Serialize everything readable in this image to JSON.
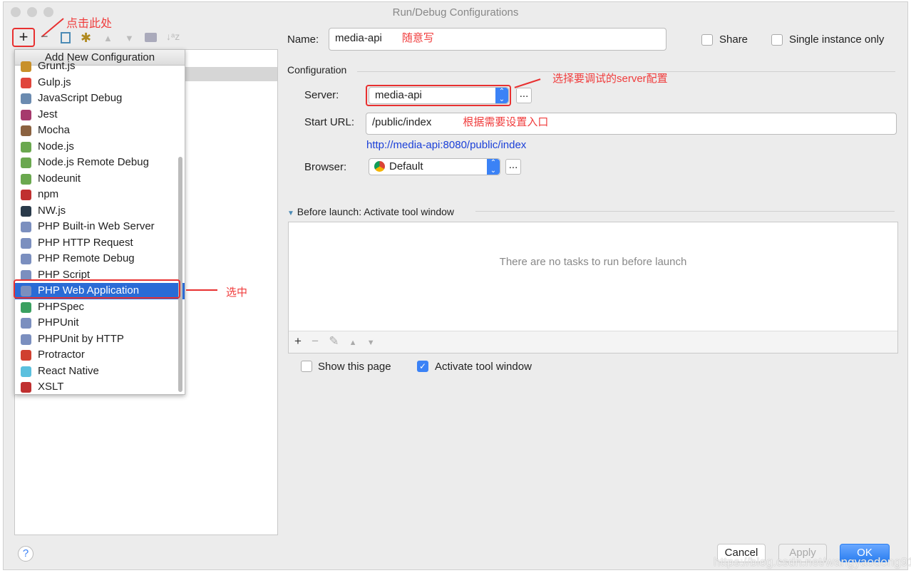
{
  "window": {
    "title": "Run/Debug Configurations"
  },
  "annotations": {
    "click_here": "点击此处",
    "name_hint": "随意写",
    "server_hint": "选择要调试的server配置",
    "url_hint": "根据需要设置入口",
    "selected_hint": "选中"
  },
  "toolbar": {
    "add": "+",
    "remove": "−",
    "sort": "↓ᵃz"
  },
  "popup": {
    "header": "Add New Configuration",
    "items": [
      {
        "label": "Grunt.js",
        "color": "#c8902a"
      },
      {
        "label": "Gulp.js",
        "color": "#e0453c"
      },
      {
        "label": "JavaScript Debug",
        "color": "#6b8bb0"
      },
      {
        "label": "Jest",
        "color": "#a63a6d"
      },
      {
        "label": "Mocha",
        "color": "#8b6240"
      },
      {
        "label": "Node.js",
        "color": "#6aa84f"
      },
      {
        "label": "Node.js Remote Debug",
        "color": "#6aa84f"
      },
      {
        "label": "Nodeunit",
        "color": "#6aa84f"
      },
      {
        "label": "npm",
        "color": "#c03030"
      },
      {
        "label": "NW.js",
        "color": "#2a3a4a"
      },
      {
        "label": "PHP Built-in Web Server",
        "color": "#7b8fbf"
      },
      {
        "label": "PHP HTTP Request",
        "color": "#7b8fbf"
      },
      {
        "label": "PHP Remote Debug",
        "color": "#7b8fbf"
      },
      {
        "label": "PHP Script",
        "color": "#7b8fbf"
      },
      {
        "label": "PHP Web Application",
        "color": "#7b8fbf"
      },
      {
        "label": "PHPSpec",
        "color": "#3aa060"
      },
      {
        "label": "PHPUnit",
        "color": "#7b8fbf"
      },
      {
        "label": "PHPUnit by HTTP",
        "color": "#7b8fbf"
      },
      {
        "label": "Protractor",
        "color": "#d04030"
      },
      {
        "label": "React Native",
        "color": "#5bc0de"
      },
      {
        "label": "XSLT",
        "color": "#c03030"
      }
    ],
    "selected": "PHP Web Application"
  },
  "form": {
    "name_label": "Name:",
    "name_value": "media-api",
    "share": "Share",
    "single_instance": "Single instance only",
    "configuration": "Configuration",
    "server_label": "Server:",
    "server_value": "media-api",
    "start_url_label": "Start URL:",
    "start_url_value": "/public/index",
    "resolved_url": "http://media-api:8080/public/index",
    "browser_label": "Browser:",
    "browser_value": "Default",
    "dots": "..."
  },
  "before_launch": {
    "title": "Before launch: Activate tool window",
    "empty": "There are no tasks to run before launch",
    "show_page": "Show this page",
    "activate": "Activate tool window",
    "activate_checked": true,
    "show_page_checked": false
  },
  "footer": {
    "help": "?",
    "cancel": "Cancel",
    "apply": "Apply",
    "ok": "OK"
  },
  "watermark": "https://blog.csdn.net/wangyaodong915"
}
